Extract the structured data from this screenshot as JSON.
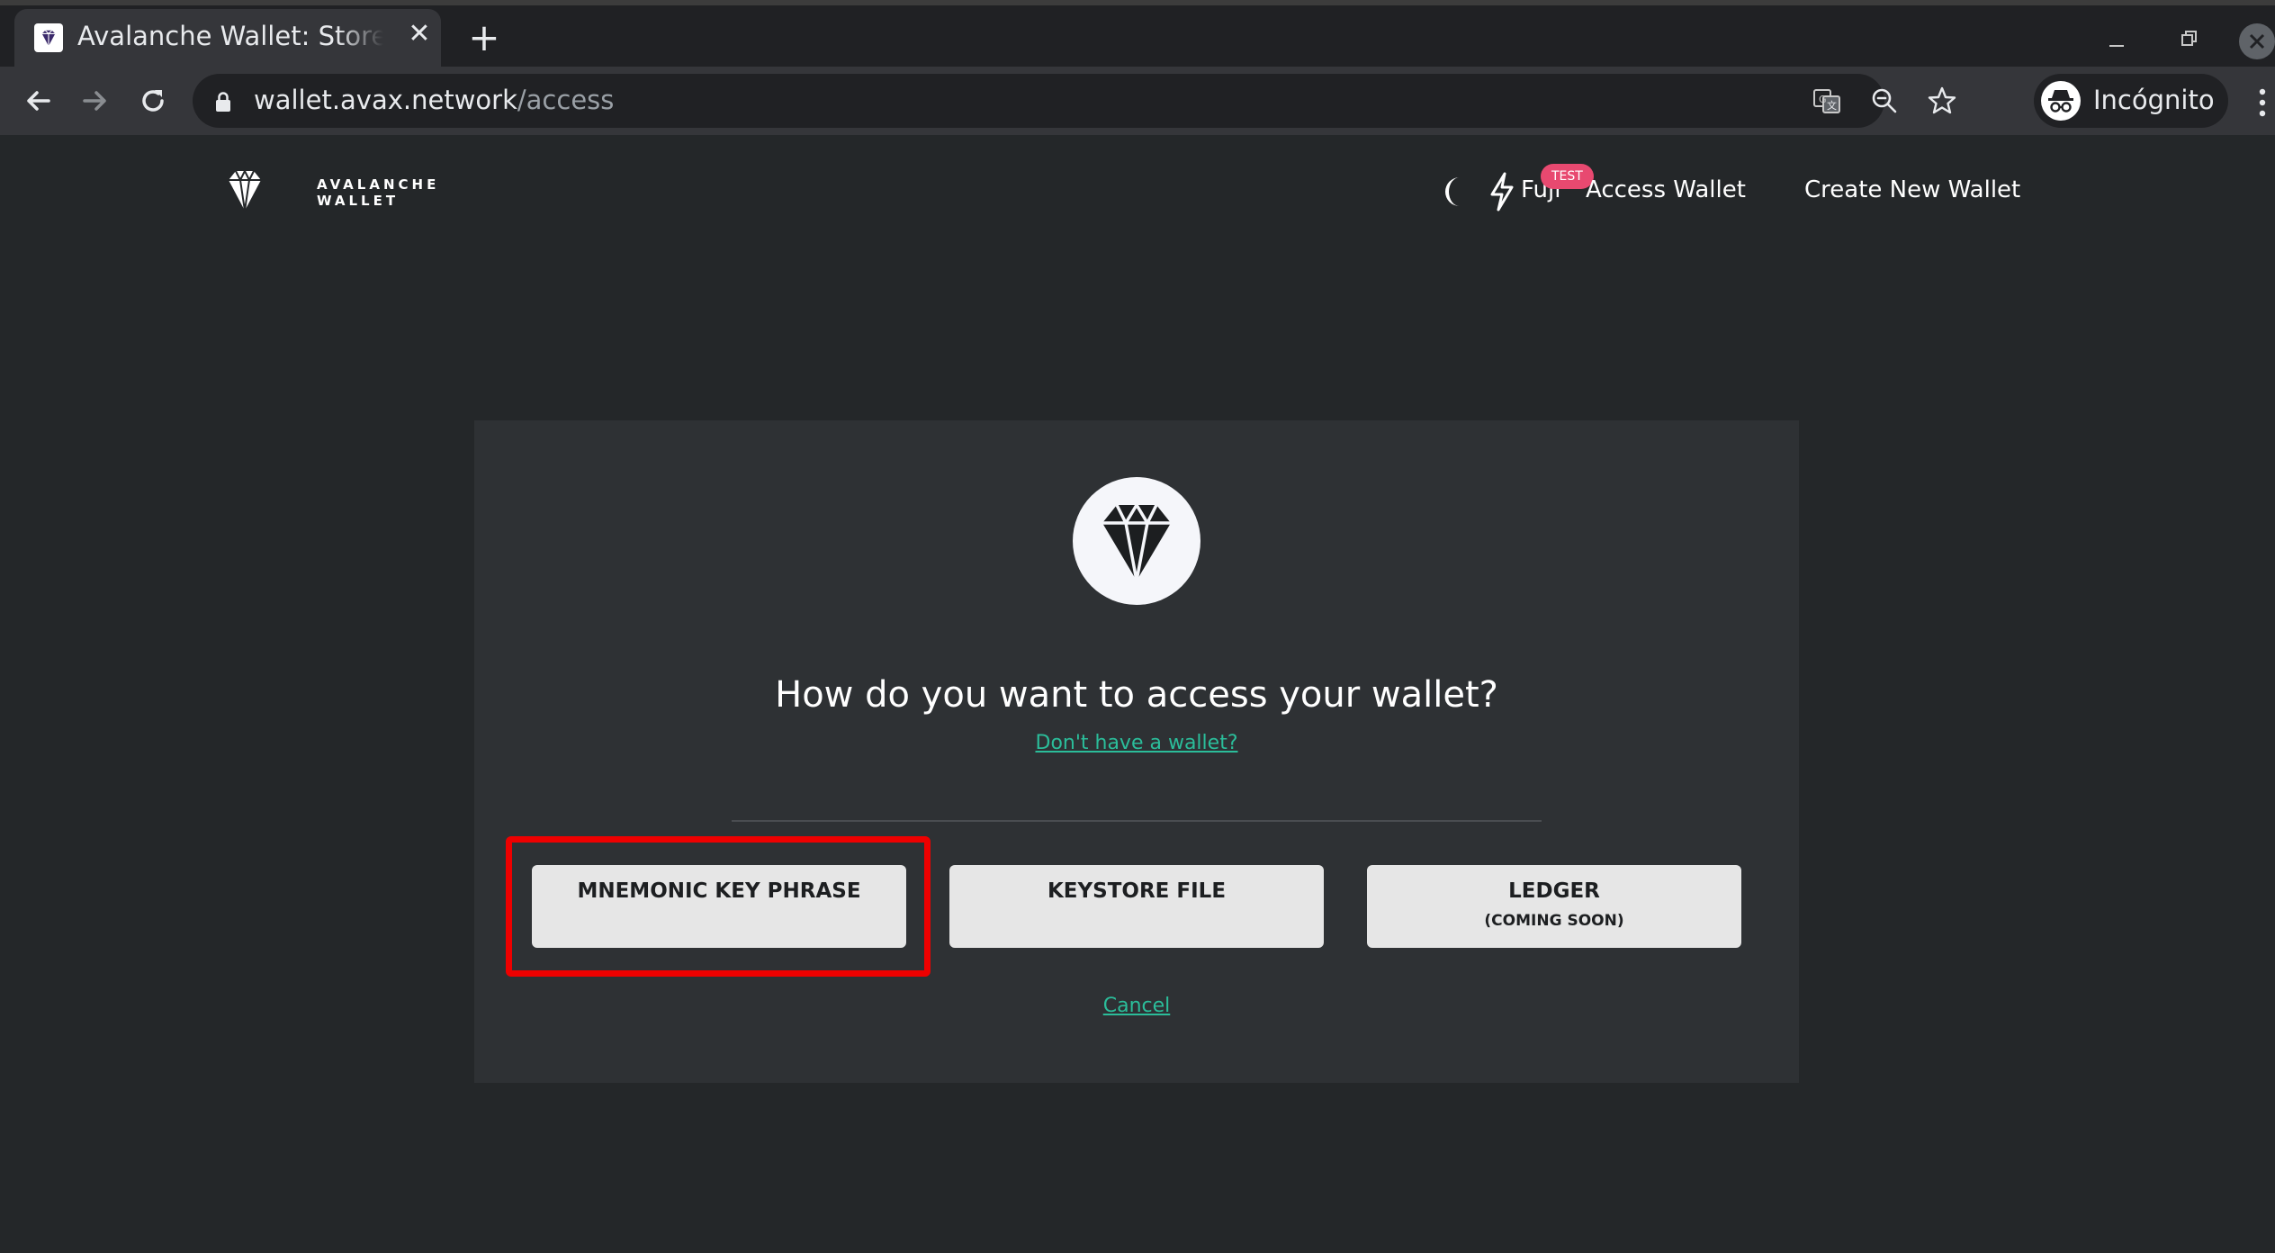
{
  "browser": {
    "tab_title": "Avalanche Wallet: Store Your",
    "tab_close": "✕",
    "new_tab": "+",
    "url_host": "wallet.avax.network",
    "url_path": "/access",
    "profile_label": "Incógnito"
  },
  "header": {
    "logo_line1": "AVALANCHE",
    "logo_line2": "WALLET",
    "network_name": "Fuji",
    "network_badge": "TEST",
    "nav_access": "Access Wallet",
    "nav_create": "Create New Wallet"
  },
  "access": {
    "title": "How do you want to access your wallet?",
    "no_wallet_link": "Don't have a wallet?",
    "options": [
      {
        "label": "MNEMONIC KEY PHRASE",
        "sub": ""
      },
      {
        "label": "KEYSTORE FILE",
        "sub": ""
      },
      {
        "label": "LEDGER",
        "sub": "(COMING SOON)"
      }
    ],
    "cancel": "Cancel"
  },
  "colors": {
    "page_bg": "#242729",
    "card_bg": "#2e3134",
    "link": "#2bbd9a",
    "badge": "#e84970",
    "highlight": "#ee0000"
  }
}
